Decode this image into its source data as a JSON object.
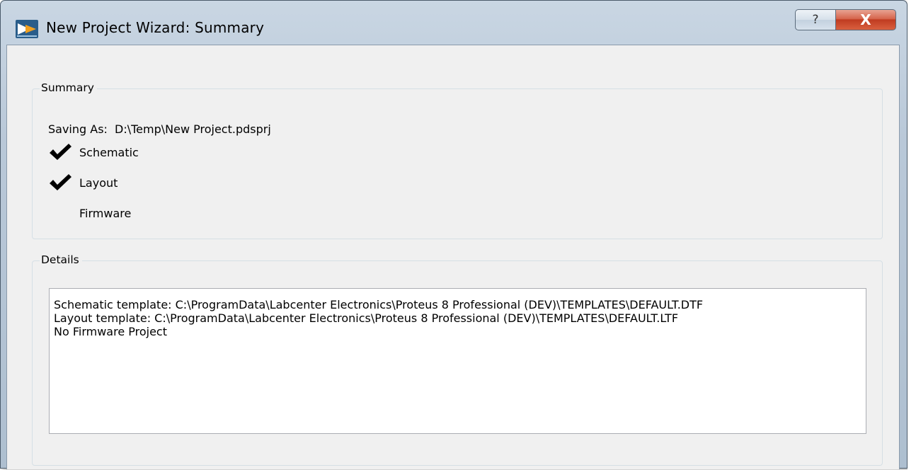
{
  "window": {
    "title": "New Project Wizard: Summary",
    "help_button_glyph": "?",
    "close_button_glyph": "X",
    "app_icon": "proteus-app-icon"
  },
  "summary": {
    "group_label": "Summary",
    "saving_as_label": "Saving As:",
    "saving_as_value": "D:\\Temp\\New Project.pdsprj",
    "items": [
      {
        "label": "Schematic",
        "checked": true
      },
      {
        "label": "Layout",
        "checked": true
      },
      {
        "label": "Firmware",
        "checked": false
      }
    ]
  },
  "details": {
    "group_label": "Details",
    "lines": [
      "Schematic template: C:\\ProgramData\\Labcenter Electronics\\Proteus 8 Professional (DEV)\\TEMPLATES\\DEFAULT.DTF",
      "Layout template: C:\\ProgramData\\Labcenter Electronics\\Proteus 8 Professional (DEV)\\TEMPLATES\\DEFAULT.LTF",
      "No Firmware Project"
    ]
  },
  "colors": {
    "titlebar": "#b9c8d8",
    "client_bg": "#f0f0f0",
    "close_button": "#c03c21",
    "text": "#000000"
  }
}
